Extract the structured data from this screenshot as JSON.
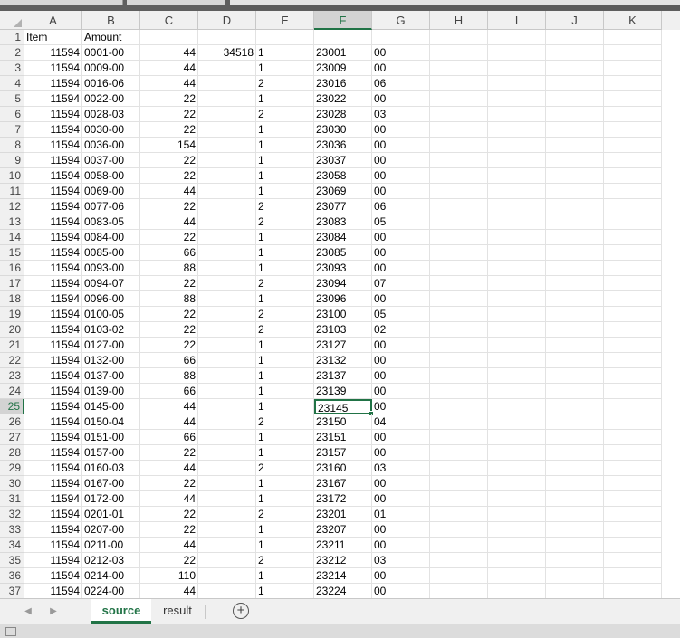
{
  "columns": [
    "A",
    "B",
    "C",
    "D",
    "E",
    "F",
    "G",
    "H",
    "I",
    "J",
    "K"
  ],
  "selected_column": "F",
  "selected_row": 25,
  "header_row": {
    "A": "Item",
    "B": "Amount"
  },
  "rows": [
    {
      "r": 2,
      "A": "11594",
      "B": "0001-00",
      "C": "44",
      "D": "34518",
      "E": "1",
      "F": "23001",
      "G": "00"
    },
    {
      "r": 3,
      "A": "11594",
      "B": "0009-00",
      "C": "44",
      "D": "",
      "E": "1",
      "F": "23009",
      "G": "00"
    },
    {
      "r": 4,
      "A": "11594",
      "B": "0016-06",
      "C": "44",
      "D": "",
      "E": "2",
      "F": "23016",
      "G": "06"
    },
    {
      "r": 5,
      "A": "11594",
      "B": "0022-00",
      "C": "22",
      "D": "",
      "E": "1",
      "F": "23022",
      "G": "00"
    },
    {
      "r": 6,
      "A": "11594",
      "B": "0028-03",
      "C": "22",
      "D": "",
      "E": "2",
      "F": "23028",
      "G": "03"
    },
    {
      "r": 7,
      "A": "11594",
      "B": "0030-00",
      "C": "22",
      "D": "",
      "E": "1",
      "F": "23030",
      "G": "00"
    },
    {
      "r": 8,
      "A": "11594",
      "B": "0036-00",
      "C": "154",
      "D": "",
      "E": "1",
      "F": "23036",
      "G": "00"
    },
    {
      "r": 9,
      "A": "11594",
      "B": "0037-00",
      "C": "22",
      "D": "",
      "E": "1",
      "F": "23037",
      "G": "00"
    },
    {
      "r": 10,
      "A": "11594",
      "B": "0058-00",
      "C": "22",
      "D": "",
      "E": "1",
      "F": "23058",
      "G": "00"
    },
    {
      "r": 11,
      "A": "11594",
      "B": "0069-00",
      "C": "44",
      "D": "",
      "E": "1",
      "F": "23069",
      "G": "00"
    },
    {
      "r": 12,
      "A": "11594",
      "B": "0077-06",
      "C": "22",
      "D": "",
      "E": "2",
      "F": "23077",
      "G": "06"
    },
    {
      "r": 13,
      "A": "11594",
      "B": "0083-05",
      "C": "44",
      "D": "",
      "E": "2",
      "F": "23083",
      "G": "05"
    },
    {
      "r": 14,
      "A": "11594",
      "B": "0084-00",
      "C": "22",
      "D": "",
      "E": "1",
      "F": "23084",
      "G": "00"
    },
    {
      "r": 15,
      "A": "11594",
      "B": "0085-00",
      "C": "66",
      "D": "",
      "E": "1",
      "F": "23085",
      "G": "00"
    },
    {
      "r": 16,
      "A": "11594",
      "B": "0093-00",
      "C": "88",
      "D": "",
      "E": "1",
      "F": "23093",
      "G": "00"
    },
    {
      "r": 17,
      "A": "11594",
      "B": "0094-07",
      "C": "22",
      "D": "",
      "E": "2",
      "F": "23094",
      "G": "07"
    },
    {
      "r": 18,
      "A": "11594",
      "B": "0096-00",
      "C": "88",
      "D": "",
      "E": "1",
      "F": "23096",
      "G": "00"
    },
    {
      "r": 19,
      "A": "11594",
      "B": "0100-05",
      "C": "22",
      "D": "",
      "E": "2",
      "F": "23100",
      "G": "05"
    },
    {
      "r": 20,
      "A": "11594",
      "B": "0103-02",
      "C": "22",
      "D": "",
      "E": "2",
      "F": "23103",
      "G": "02"
    },
    {
      "r": 21,
      "A": "11594",
      "B": "0127-00",
      "C": "22",
      "D": "",
      "E": "1",
      "F": "23127",
      "G": "00"
    },
    {
      "r": 22,
      "A": "11594",
      "B": "0132-00",
      "C": "66",
      "D": "",
      "E": "1",
      "F": "23132",
      "G": "00"
    },
    {
      "r": 23,
      "A": "11594",
      "B": "0137-00",
      "C": "88",
      "D": "",
      "E": "1",
      "F": "23137",
      "G": "00"
    },
    {
      "r": 24,
      "A": "11594",
      "B": "0139-00",
      "C": "66",
      "D": "",
      "E": "1",
      "F": "23139",
      "G": "00"
    },
    {
      "r": 25,
      "A": "11594",
      "B": "0145-00",
      "C": "44",
      "D": "",
      "E": "1",
      "F": "23145",
      "G": "00"
    },
    {
      "r": 26,
      "A": "11594",
      "B": "0150-04",
      "C": "44",
      "D": "",
      "E": "2",
      "F": "23150",
      "G": "04"
    },
    {
      "r": 27,
      "A": "11594",
      "B": "0151-00",
      "C": "66",
      "D": "",
      "E": "1",
      "F": "23151",
      "G": "00"
    },
    {
      "r": 28,
      "A": "11594",
      "B": "0157-00",
      "C": "22",
      "D": "",
      "E": "1",
      "F": "23157",
      "G": "00"
    },
    {
      "r": 29,
      "A": "11594",
      "B": "0160-03",
      "C": "44",
      "D": "",
      "E": "2",
      "F": "23160",
      "G": "03"
    },
    {
      "r": 30,
      "A": "11594",
      "B": "0167-00",
      "C": "22",
      "D": "",
      "E": "1",
      "F": "23167",
      "G": "00"
    },
    {
      "r": 31,
      "A": "11594",
      "B": "0172-00",
      "C": "44",
      "D": "",
      "E": "1",
      "F": "23172",
      "G": "00"
    },
    {
      "r": 32,
      "A": "11594",
      "B": "0201-01",
      "C": "22",
      "D": "",
      "E": "2",
      "F": "23201",
      "G": "01"
    },
    {
      "r": 33,
      "A": "11594",
      "B": "0207-00",
      "C": "22",
      "D": "",
      "E": "1",
      "F": "23207",
      "G": "00"
    },
    {
      "r": 34,
      "A": "11594",
      "B": "0211-00",
      "C": "44",
      "D": "",
      "E": "1",
      "F": "23211",
      "G": "00"
    },
    {
      "r": 35,
      "A": "11594",
      "B": "0212-03",
      "C": "22",
      "D": "",
      "E": "2",
      "F": "23212",
      "G": "03"
    },
    {
      "r": 36,
      "A": "11594",
      "B": "0214-00",
      "C": "110",
      "D": "",
      "E": "1",
      "F": "23214",
      "G": "00"
    },
    {
      "r": 37,
      "A": "11594",
      "B": "0224-00",
      "C": "44",
      "D": "",
      "E": "1",
      "F": "23224",
      "G": "00"
    }
  ],
  "sheet_tabs": [
    {
      "label": "source",
      "active": true
    },
    {
      "label": "result",
      "active": false
    }
  ],
  "add_sheet_label": "+",
  "nav_prev": "◀",
  "nav_next": "▶",
  "accent_color": "#217346"
}
